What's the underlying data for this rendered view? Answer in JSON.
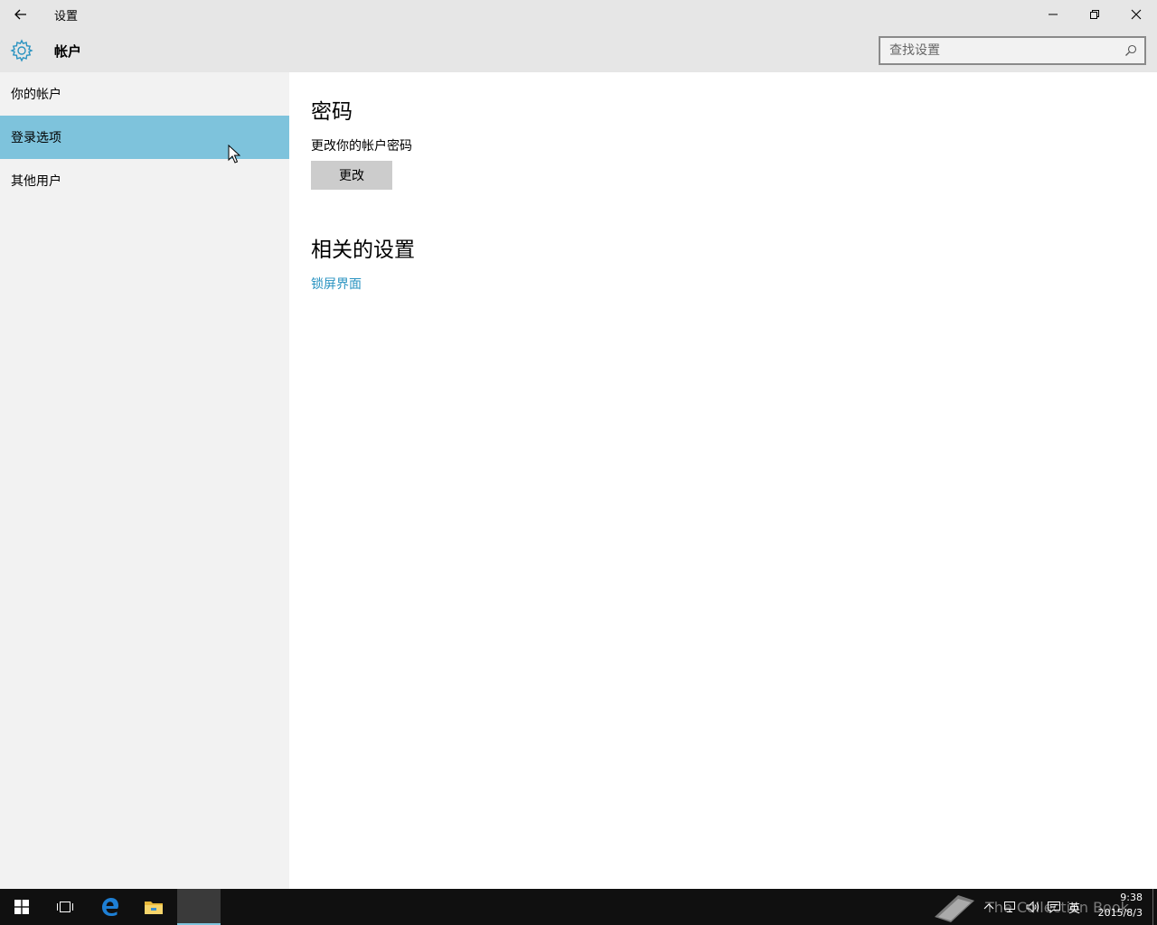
{
  "window": {
    "title": "设置"
  },
  "header": {
    "title": "帐户",
    "search_placeholder": "查找设置"
  },
  "sidebar": {
    "items": [
      {
        "label": "你的帐户",
        "selected": false
      },
      {
        "label": "登录选项",
        "selected": true
      },
      {
        "label": "其他用户",
        "selected": false
      }
    ]
  },
  "main": {
    "password": {
      "title": "密码",
      "description": "更改你的帐户密码",
      "button_label": "更改"
    },
    "related": {
      "title": "相关的设置",
      "link_label": "锁屏界面"
    }
  },
  "taskbar": {
    "watermark": "The Collection Book",
    "language": "英",
    "time": "9:38",
    "date": "2015/8/3"
  },
  "colors": {
    "accent": "#7ec3dc",
    "link": "#2a93c1",
    "titlebar": "#e6e6e6",
    "sidebar": "#f2f2f2",
    "taskbar": "#101010"
  }
}
